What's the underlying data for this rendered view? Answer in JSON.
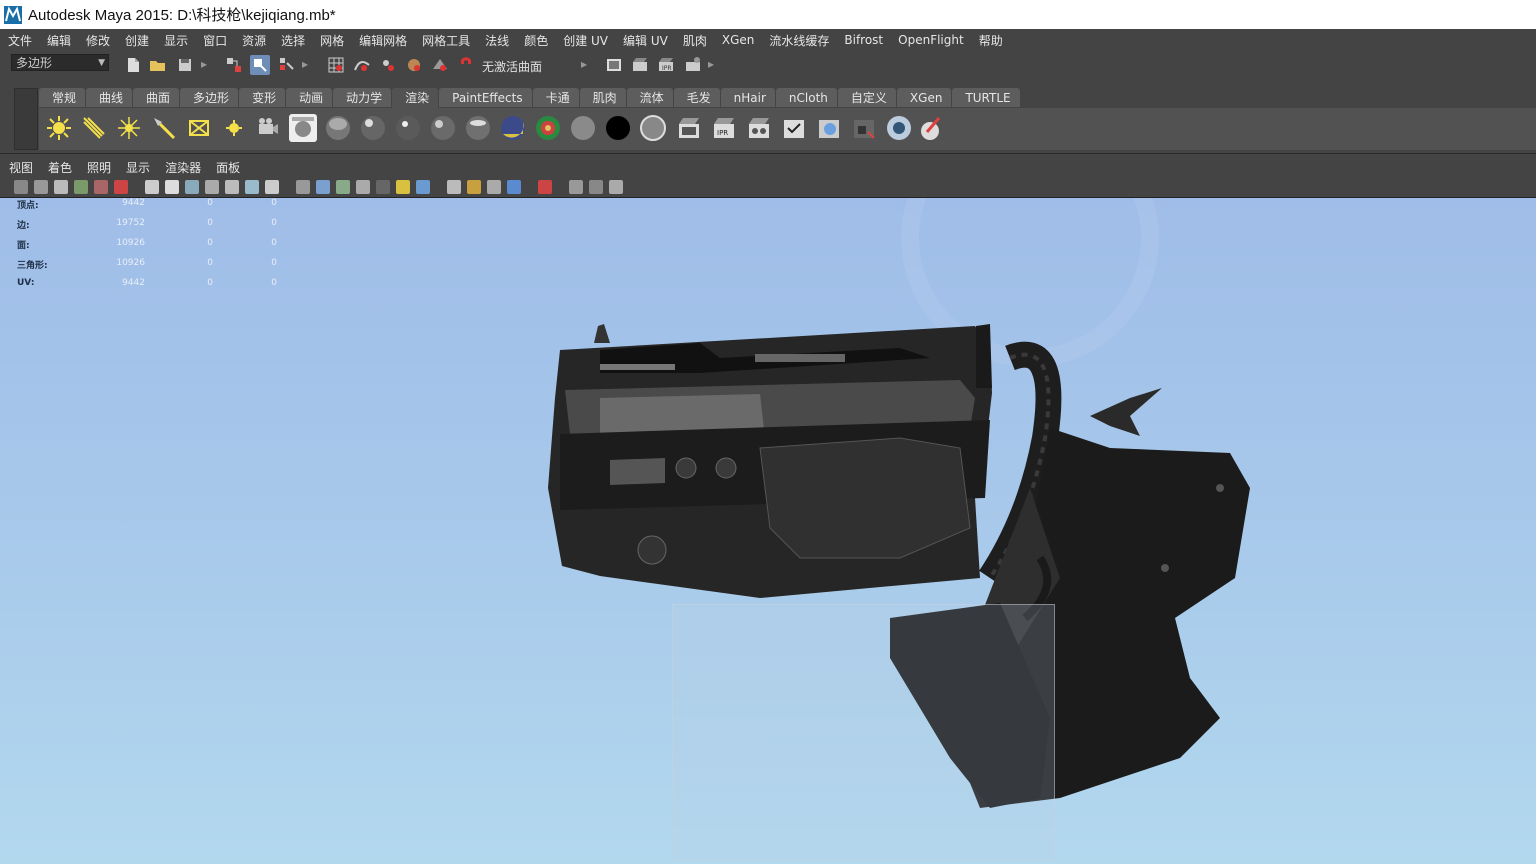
{
  "window": {
    "title": "Autodesk Maya 2015: D:\\科技枪\\kejiqiang.mb*"
  },
  "menubar": [
    "文件",
    "编辑",
    "修改",
    "创建",
    "显示",
    "窗口",
    "资源",
    "选择",
    "网格",
    "编辑网格",
    "网格工具",
    "法线",
    "颜色",
    "创建 UV",
    "编辑 UV",
    "肌肉",
    "XGen",
    "流水线缓存",
    "Bifrost",
    "OpenFlight",
    "帮助"
  ],
  "statusline": {
    "menu_set": "多边形",
    "live_surface": "无激活曲面"
  },
  "shelf": {
    "tabs": [
      "常规",
      "曲线",
      "曲面",
      "多边形",
      "变形",
      "动画",
      "动力学",
      "渲染",
      "PaintEffects",
      "卡通",
      "肌肉",
      "流体",
      "毛发",
      "nHair",
      "nCloth",
      "自定义",
      "XGen",
      "TURTLE"
    ],
    "active_tab": "渲染"
  },
  "panel_menu": [
    "视图",
    "着色",
    "照明",
    "显示",
    "渲染器",
    "面板"
  ],
  "hud": [
    {
      "label": "顶点:",
      "v1": "9442",
      "v2": "0",
      "v3": "0"
    },
    {
      "label": "边:",
      "v1": "19752",
      "v2": "0",
      "v3": "0"
    },
    {
      "label": "面:",
      "v1": "10926",
      "v2": "0",
      "v3": "0"
    },
    {
      "label": "三角形:",
      "v1": "10926",
      "v2": "0",
      "v3": "0"
    },
    {
      "label": "UV:",
      "v1": "9442",
      "v2": "0",
      "v3": "0"
    }
  ],
  "colors": {
    "ui_bg": "#444444",
    "shelf_bg": "#525252",
    "viewport_top": "#9fbde8",
    "viewport_bottom": "#b2d8ee"
  }
}
